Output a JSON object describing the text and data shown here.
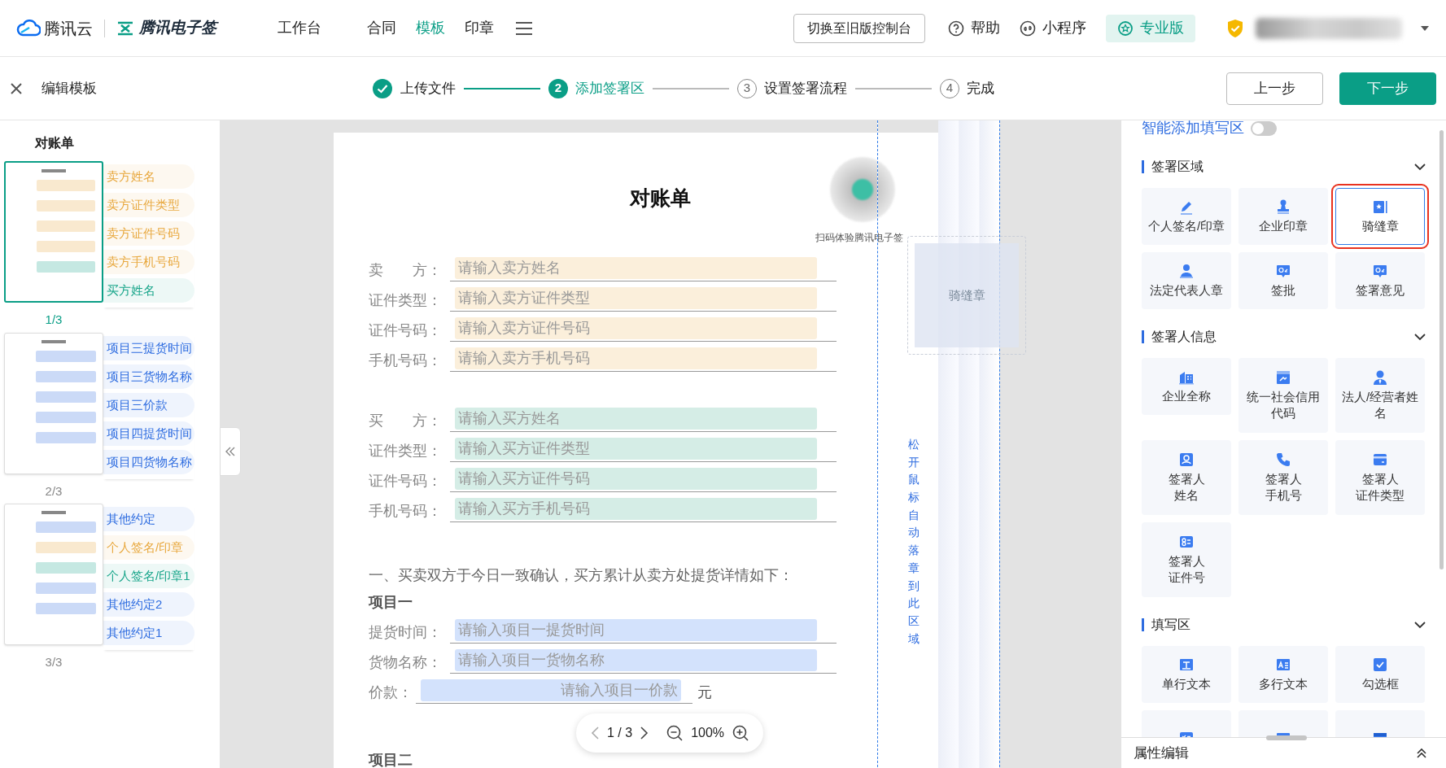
{
  "top_nav": {
    "brand": "腾讯云",
    "product": "腾讯电子签",
    "menu": [
      {
        "label": "工作台",
        "selected": false
      },
      {
        "label": "合同",
        "selected": false
      },
      {
        "label": "模板",
        "selected": true
      },
      {
        "label": "印章",
        "selected": false
      }
    ],
    "legacy_button": "切换至旧版控制台",
    "links": [
      {
        "label": "帮助",
        "kind": "help"
      },
      {
        "label": "小程序",
        "kind": "miniapp"
      }
    ],
    "edition_badge": "专业版"
  },
  "toolbar": {
    "title": "编辑模板",
    "steps": [
      {
        "label": "上传文件",
        "completed": true,
        "selected": false
      },
      {
        "number": "2",
        "label": "添加签署区",
        "completed": false,
        "selected": true
      },
      {
        "number": "3",
        "label": "设置签署流程",
        "completed": false,
        "selected": false
      },
      {
        "number": "4",
        "label": "完成",
        "completed": false,
        "selected": false
      }
    ],
    "buttons": [
      {
        "label": "上一步",
        "kind": "secondary"
      },
      {
        "label": "下一步",
        "kind": "primary"
      }
    ]
  },
  "outline": {
    "title": "对账单",
    "pages": [
      {
        "label": "1/3",
        "selected": true,
        "fields": [
          {
            "label": "卖方姓名",
            "color": "#e8a83e"
          },
          {
            "label": "卖方证件类型",
            "color": "#e8a83e"
          },
          {
            "label": "卖方证件号码",
            "color": "#e8a83e"
          },
          {
            "label": "卖方手机号码",
            "color": "#e8a83e"
          },
          {
            "label": "买方姓名",
            "color": "#18a58a"
          }
        ]
      },
      {
        "label": "2/3",
        "selected": false,
        "fields": [
          {
            "label": "项目三提货时间",
            "color": "#2f6de0"
          },
          {
            "label": "项目三货物名称",
            "color": "#2f6de0"
          },
          {
            "label": "项目三价款",
            "color": "#2f6de0"
          },
          {
            "label": "项目四提货时间",
            "color": "#2f6de0"
          },
          {
            "label": "项目四货物名称",
            "color": "#2f6de0"
          }
        ]
      },
      {
        "label": "3/3",
        "selected": false,
        "fields": [
          {
            "label": "其他约定",
            "color": "#2f6de0"
          },
          {
            "label": "个人签名/印章",
            "color": "#e8a83e"
          },
          {
            "label": "个人签名/印章1",
            "color": "#18a58a"
          },
          {
            "label": "其他约定2",
            "color": "#2f6de0"
          },
          {
            "label": "其他约定1",
            "color": "#2f6de0"
          }
        ]
      }
    ]
  },
  "document": {
    "title": "对账单",
    "qr_caption": "扫码体验腾讯电子签",
    "field_groups": [
      {
        "color": "#fbefdb",
        "rows": [
          {
            "label": "卖　　方：",
            "placeholder": "请输入卖方姓名"
          },
          {
            "label": "证件类型：",
            "placeholder": "请输入卖方证件类型"
          },
          {
            "label": "证件号码：",
            "placeholder": "请输入卖方证件号码"
          },
          {
            "label": "手机号码：",
            "placeholder": "请输入卖方手机号码"
          }
        ]
      },
      {
        "color": "#d5ede6",
        "rows": [
          {
            "label": "买　　方：",
            "placeholder": "请输入买方姓名"
          },
          {
            "label": "证件类型：",
            "placeholder": "请输入买方证件类型"
          },
          {
            "label": "证件号码：",
            "placeholder": "请输入买方证件号码"
          },
          {
            "label": "手机号码：",
            "placeholder": "请输入买方手机号码"
          }
        ]
      }
    ],
    "paragraph": "一、买卖双方于今日一致确认，买方累计从卖方处提货详情如下：",
    "item_heading": "项目一",
    "items": {
      "color": "#d3e2fc",
      "rows": [
        {
          "label": "提货时间：",
          "placeholder": "请输入项目一提货时间",
          "kind": "wide"
        },
        {
          "label": "货物名称：",
          "placeholder": "请输入项目一货物名称",
          "kind": "wide"
        },
        {
          "label": "价款：",
          "placeholder": "请输入项目一价款",
          "kind": "amount",
          "suffix": "元"
        }
      ]
    },
    "next_heading": "项目二",
    "seam_stamp": {
      "label": "骑缝章",
      "hint": "松开鼠标自动落章到此区域"
    },
    "pager": {
      "page": "1 / 3",
      "zoom": "100%"
    }
  },
  "panel": {
    "smart_fill": {
      "label": "智能添加填写区",
      "on": false
    },
    "sections": [
      {
        "title": "签署区域",
        "expanded": true,
        "items": [
          {
            "lines": [
              "个人签名/印章"
            ],
            "kind": "pen",
            "selected": false
          },
          {
            "lines": [
              "企业印章"
            ],
            "kind": "stamp",
            "selected": false
          },
          {
            "lines": [
              "骑缝章"
            ],
            "kind": "seam",
            "selected": true
          },
          {
            "lines": [
              "法定代表人章"
            ],
            "kind": "person-stamp",
            "selected": false
          },
          {
            "lines": [
              "签批"
            ],
            "kind": "approve",
            "selected": false
          },
          {
            "lines": [
              "签署意见"
            ],
            "kind": "approve",
            "selected": false
          }
        ]
      },
      {
        "title": "签署人信息",
        "expanded": true,
        "items": [
          {
            "lines": [
              "企业全称"
            ],
            "kind": "building",
            "selected": false
          },
          {
            "lines": [
              "统一社会信用代码"
            ],
            "kind": "credit",
            "selected": false
          },
          {
            "lines": [
              "法人/经营者姓名"
            ],
            "kind": "person",
            "selected": false
          },
          {
            "lines": [
              "签署人",
              "姓名"
            ],
            "kind": "contact",
            "selected": false
          },
          {
            "lines": [
              "签署人",
              "手机号"
            ],
            "kind": "phone",
            "selected": false
          },
          {
            "lines": [
              "签署人",
              "证件类型"
            ],
            "kind": "card",
            "selected": false
          },
          {
            "lines": [
              "签署人",
              "证件号"
            ],
            "kind": "idcard",
            "selected": false
          }
        ]
      },
      {
        "title": "填写区",
        "expanded": true,
        "items": [
          {
            "lines": [
              "单行文本"
            ],
            "kind": "text",
            "selected": false
          },
          {
            "lines": [
              "多行文本"
            ],
            "kind": "multiline",
            "selected": false
          },
          {
            "lines": [
              "勾选框"
            ],
            "kind": "checkbox",
            "selected": false
          },
          {
            "kind": "checklist",
            "selected": false
          },
          {
            "kind": "number",
            "selected": false
          },
          {
            "kind": "calendar",
            "selected": false
          }
        ]
      }
    ],
    "property_panel": {
      "title": "属性编辑",
      "expanded": false
    }
  }
}
